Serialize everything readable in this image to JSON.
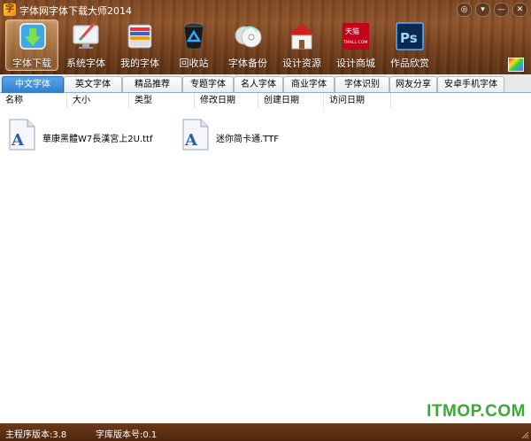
{
  "window": {
    "title": "字体网字体下载大师2014",
    "buttons": [
      "◎",
      "▾",
      "—",
      "✕"
    ]
  },
  "toolbar": {
    "items": [
      {
        "label": "字体下载",
        "icon": "download-icon",
        "active": true
      },
      {
        "label": "系统字体",
        "icon": "monitor-brush-icon",
        "active": false
      },
      {
        "label": "我的字体",
        "icon": "folder-fonts-icon",
        "active": false
      },
      {
        "label": "回收站",
        "icon": "recycle-bin-icon",
        "active": false
      },
      {
        "label": "字体备份",
        "icon": "cd-backup-icon",
        "active": false
      },
      {
        "label": "设计资源",
        "icon": "house-icon",
        "active": false
      },
      {
        "label": "设计商城",
        "icon": "tmall-icon",
        "active": false,
        "badge_top": "天猫",
        "badge_bottom": "TMALL.COM"
      },
      {
        "label": "作品欣赏",
        "icon": "photoshop-icon",
        "active": false,
        "badge": "Ps"
      }
    ],
    "skin_icon": "color-palette-icon"
  },
  "tabs": [
    {
      "label": "中文字体",
      "selected": true
    },
    {
      "label": "英文字体",
      "selected": false
    },
    {
      "label": "精品推荐",
      "selected": false
    },
    {
      "label": "专题字体",
      "selected": false
    },
    {
      "label": "名人字体",
      "selected": false
    },
    {
      "label": "商业字体",
      "selected": false
    },
    {
      "label": "字体识别",
      "selected": false
    },
    {
      "label": "网友分享",
      "selected": false
    },
    {
      "label": "安卓手机字体",
      "selected": false
    }
  ],
  "columns": [
    "名称",
    "大小",
    "类型",
    "修改日期",
    "创建日期",
    "访问日期"
  ],
  "files": [
    {
      "name": "華康黑體W7長漢宮上2U.ttf",
      "icon": "font-file-icon",
      "glyph": "A"
    },
    {
      "name": "迷你简卡通.TTF",
      "icon": "font-file-icon",
      "glyph": "A"
    }
  ],
  "watermark": "ITMOP.COM",
  "status": {
    "program_version": "主程序版本:3.8",
    "library_version": "字库版本号:0.1"
  },
  "colors": {
    "accent_tab": "#2f7fcf",
    "watermark": "#3aaa35",
    "wood": "#7a4420"
  }
}
